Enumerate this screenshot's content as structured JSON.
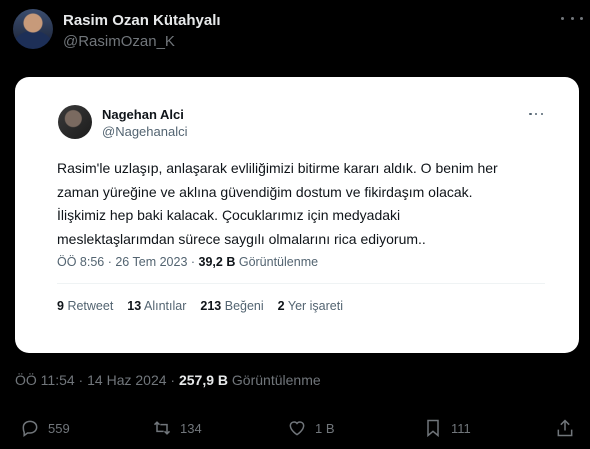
{
  "tweet": {
    "author_name": "Rasim Ozan Kütahyalı",
    "author_handle": "@RasimOzan_K",
    "time": "ÖÖ 11:54",
    "date": "14 Haz 2024",
    "views_count": "257,9 B",
    "views_label": "Görüntülenme",
    "actions": {
      "replies": "559",
      "retweets": "134",
      "likes": "1 B",
      "bookmarks": "111"
    }
  },
  "quoted": {
    "author_name": "Nagehan Alci",
    "author_handle": "@Nagehanalci",
    "text": "Rasim'le uzlaşıp, anlaşarak evliliğimizi bitirme kararı aldık. O benim her\nzaman yüreğine ve aklına güvendiğim dostum ve fikirdaşım olacak.\nİlişkimiz hep baki kalacak. Çocuklarımız için medyadaki\nmeslektaşlarımdan sürece saygılı olmalarını rica ediyorum..",
    "time": "ÖÖ 8:56",
    "date": "26 Tem 2023",
    "views_count": "39,2 B",
    "views_label": "Görüntülenme",
    "stats": {
      "retweets_count": "9",
      "retweets_label": "Retweet",
      "quotes_count": "13",
      "quotes_label": "Alıntılar",
      "likes_count": "213",
      "likes_label": "Beğeni",
      "bookmarks_count": "2",
      "bookmarks_label": "Yer işareti"
    }
  },
  "icons": {
    "reply": "comment-icon",
    "retweet": "retweet-icon",
    "like": "heart-icon",
    "bookmark": "bookmark-icon",
    "share": "share-icon",
    "more": "more-icon"
  },
  "colors": {
    "background": "#000000",
    "card": "#ffffff",
    "muted": "#71767b",
    "text": "#e7e9ea"
  }
}
